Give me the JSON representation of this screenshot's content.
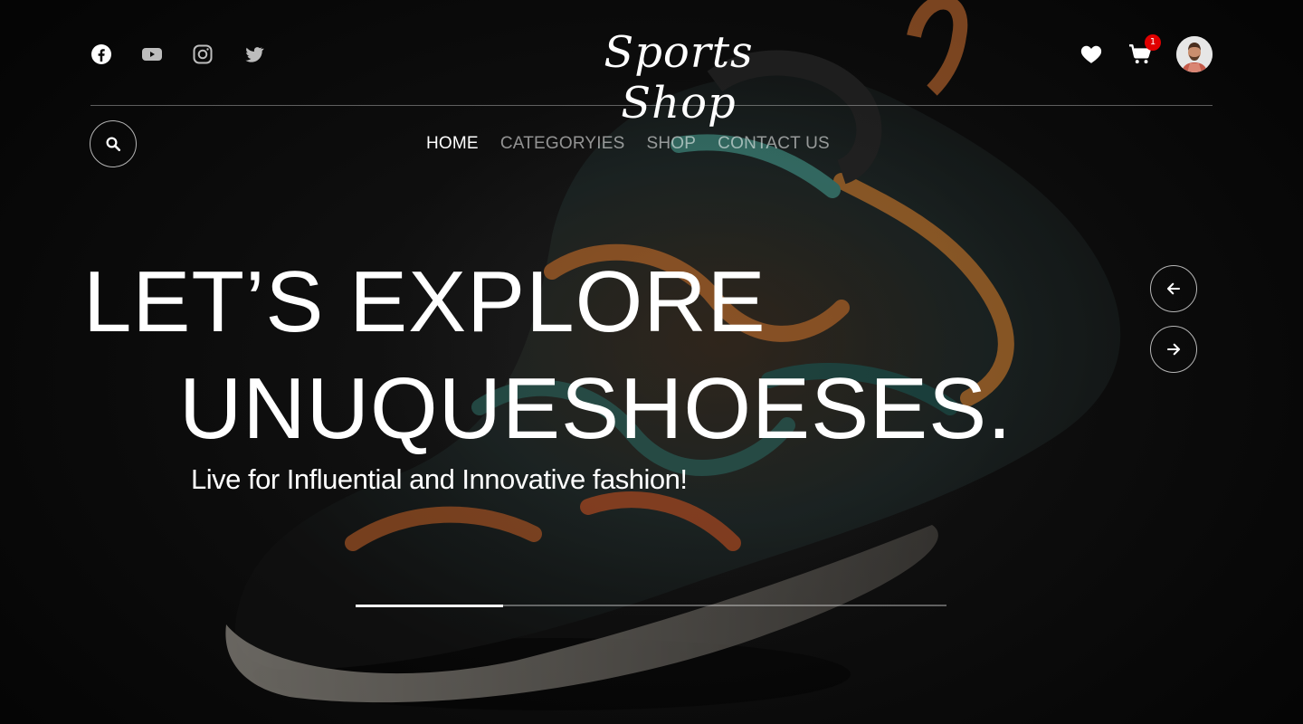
{
  "header": {
    "logo": "Sports Shop",
    "socials": [
      {
        "icon": "facebook-icon"
      },
      {
        "icon": "youtube-icon"
      },
      {
        "icon": "instagram-icon"
      },
      {
        "icon": "twitter-icon"
      }
    ],
    "cart_count": "1"
  },
  "nav": {
    "items": [
      {
        "label": "HOME",
        "active": true
      },
      {
        "label": "CATEGORYIES",
        "active": false
      },
      {
        "label": "SHOP",
        "active": false
      },
      {
        "label": "CONTACT US",
        "active": false
      }
    ]
  },
  "hero": {
    "headline_line1": "LET’S EXPLORE",
    "headline_line2": "UNUQUESHOESES.",
    "subline": "Live for Influential and Innovative fashion!",
    "slide_progress": 0.25
  },
  "colors": {
    "background": "#0b0b0b",
    "text": "#ffffff",
    "badge": "#e10000",
    "muted_nav": "rgba(255,255,255,0.55)"
  }
}
